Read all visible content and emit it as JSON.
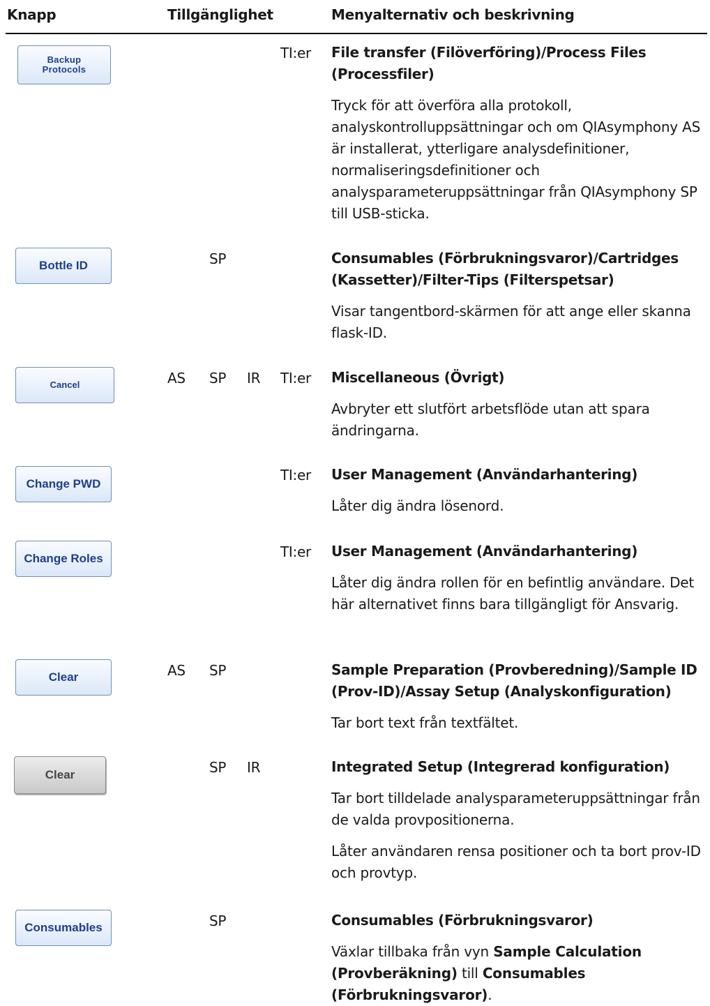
{
  "header": {
    "col_button": "Knapp",
    "col_availability": "Tillgänglighet",
    "col_description": "Menyalternativ och beskrivning"
  },
  "rows": [
    {
      "button": "Backup\nProtocols",
      "availability": {
        "as": "",
        "sp": "",
        "ir": "",
        "ti": "TI:er"
      },
      "title": "File transfer (Filöverföring)/Process Files (Processfiler)",
      "paragraphs": [
        "Tryck för att överföra alla protokoll, analyskontrolluppsättningar och om QIAsymphony AS är installerat, ytterligare analysdefinitioner, normaliseringsdefinitioner och analysparameteruppsättningar från QIAsymphony SP till USB-sticka."
      ]
    },
    {
      "button": "Bottle ID",
      "availability": {
        "as": "",
        "sp": "SP",
        "ir": "",
        "ti": ""
      },
      "title": "Consumables (Förbrukningsvaror)/Cartridges (Kassetter)/Filter-Tips (Filterspetsar)",
      "paragraphs": [
        "Visar tangentbord-skärmen för att ange eller skanna flask-ID."
      ]
    },
    {
      "button": "Cancel",
      "availability": {
        "as": "AS",
        "sp": "SP",
        "ir": "IR",
        "ti": "TI:er"
      },
      "title": "Miscellaneous (Övrigt)",
      "paragraphs": [
        "Avbryter ett slutfört arbetsflöde utan att spara ändringarna."
      ]
    },
    {
      "button": "Change PWD",
      "availability": {
        "as": "",
        "sp": "",
        "ir": "",
        "ti": "TI:er"
      },
      "title": "User Management (Användarhantering)",
      "paragraphs": [
        "Låter dig ändra lösenord."
      ]
    },
    {
      "button": "Change Roles",
      "availability": {
        "as": "",
        "sp": "",
        "ir": "",
        "ti": "TI:er"
      },
      "title": "User Management (Användarhantering)",
      "paragraphs": [
        "Låter dig ändra rollen för en befintlig användare. Det här alternativet finns bara tillgängligt för Ansvarig."
      ]
    },
    {
      "button": "Clear",
      "availability": {
        "as": "AS",
        "sp": "SP",
        "ir": "",
        "ti": ""
      },
      "title": "Sample Preparation (Provberedning)/Sample ID (Prov-ID)/Assay Setup (Analyskonfiguration)",
      "paragraphs": [
        "Tar bort text från textfältet."
      ]
    },
    {
      "button": "Clear",
      "availability": {
        "as": "",
        "sp": "SP",
        "ir": "IR",
        "ti": ""
      },
      "title": "Integrated Setup (Integrerad konfiguration)",
      "paragraphs": [
        "Tar bort tilldelade analysparameteruppsättningar från de valda provpositionerna.",
        "Låter användaren rensa positioner och ta bort prov-ID och provtyp."
      ]
    },
    {
      "button": "Consumables",
      "availability": {
        "as": "",
        "sp": "SP",
        "ir": "",
        "ti": ""
      },
      "title": "Consumables (Förbrukningsvaror)",
      "paragraphs": [],
      "rich_paragraph": {
        "pre": "Växlar tillbaka från vyn ",
        "bold1": "Sample Calculation (Provberäkning)",
        "mid": " till ",
        "bold2": "Consumables (Förbrukningsvaror)",
        "post": "."
      }
    }
  ]
}
